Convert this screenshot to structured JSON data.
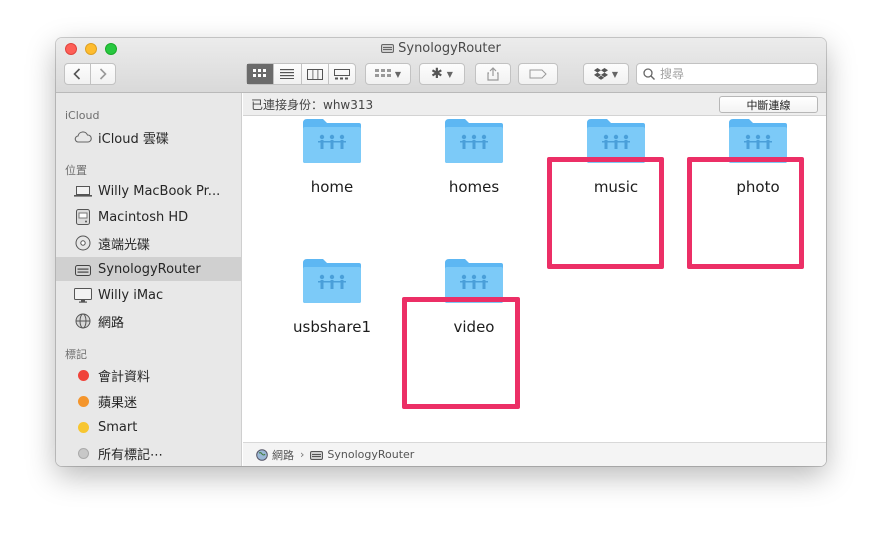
{
  "window": {
    "title": "SynologyRouter"
  },
  "toolbar": {
    "back": "‹",
    "forward": "›",
    "search_placeholder": "搜尋",
    "search_value": ""
  },
  "sidebar": {
    "sections": [
      {
        "heading": "iCloud",
        "items": [
          {
            "label": "iCloud 雲碟",
            "icon": "cloud-icon"
          }
        ]
      },
      {
        "heading": "位置",
        "items": [
          {
            "label": "Willy  MacBook Pr...",
            "icon": "laptop-icon"
          },
          {
            "label": "Macintosh HD",
            "icon": "harddisk-icon"
          },
          {
            "label": "遠端光碟",
            "icon": "disc-icon"
          },
          {
            "label": "SynologyRouter",
            "icon": "server-icon",
            "selected": true
          },
          {
            "label": "Willy  iMac",
            "icon": "monitor-icon"
          },
          {
            "label": "網路",
            "icon": "globe-icon"
          }
        ]
      },
      {
        "heading": "標記",
        "items": [
          {
            "label": "會計資料",
            "icon": "tag-red-icon",
            "color": "#f0433a"
          },
          {
            "label": "蘋果迷",
            "icon": "tag-orange-icon",
            "color": "#f4952c"
          },
          {
            "label": "Smart",
            "icon": "tag-yellow-icon",
            "color": "#f7c631"
          },
          {
            "label": "所有標記⋯",
            "icon": "tag-all-icon",
            "color": "#c8c8c8"
          }
        ]
      }
    ]
  },
  "main": {
    "connected_as": "已連接身份：whw313",
    "disconnect_label": "中斷連線",
    "folders": [
      {
        "name": "home",
        "highlighted": false
      },
      {
        "name": "homes",
        "highlighted": false
      },
      {
        "name": "music",
        "highlighted": true
      },
      {
        "name": "photo",
        "highlighted": true
      },
      {
        "name": "usbshare1",
        "highlighted": false
      },
      {
        "name": "video",
        "highlighted": true
      }
    ],
    "highlight_color": "#ec2f66",
    "folder_color": "#6cc1f5"
  },
  "pathbar": {
    "items": [
      "網路",
      "SynologyRouter"
    ]
  }
}
